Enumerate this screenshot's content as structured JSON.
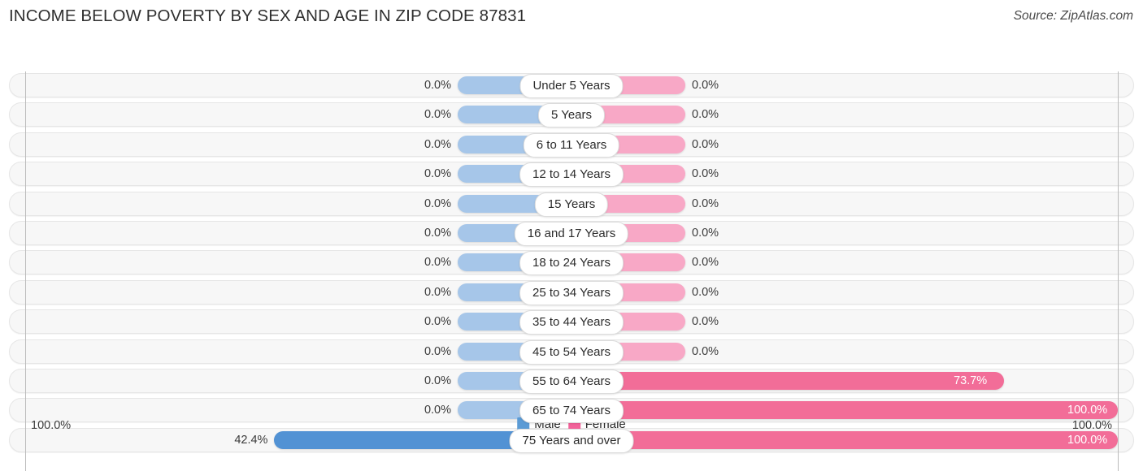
{
  "header": {
    "title": "INCOME BELOW POVERTY BY SEX AND AGE IN ZIP CODE 87831",
    "source": "Source: ZipAtlas.com"
  },
  "footer": {
    "axis_left": "100.0%",
    "axis_right": "100.0%",
    "legend": [
      {
        "label": "Male",
        "color": "#5b9bd5"
      },
      {
        "label": "Female",
        "color": "#f2639a"
      }
    ]
  },
  "colors": {
    "male_zero": "#a6c6e9",
    "female_zero": "#f8a8c6",
    "male_value": "#5292d4",
    "female_value": "#f26d98",
    "track": "#f7f7f7",
    "axis": "#bcbcbc"
  },
  "chart_data": {
    "type": "bar",
    "title": "INCOME BELOW POVERTY BY SEX AND AGE IN ZIP CODE 87831",
    "orientation": "horizontal-diverging",
    "xlabel": "",
    "ylabel": "",
    "xlim": [
      0,
      100
    ],
    "grid": false,
    "legend_position": "bottom-center",
    "categories": [
      "Under 5 Years",
      "5 Years",
      "6 to 11 Years",
      "12 to 14 Years",
      "15 Years",
      "16 and 17 Years",
      "18 to 24 Years",
      "25 to 34 Years",
      "35 to 44 Years",
      "45 to 54 Years",
      "55 to 64 Years",
      "65 to 74 Years",
      "75 Years and over"
    ],
    "series": [
      {
        "name": "Male",
        "values": [
          0.0,
          0.0,
          0.0,
          0.0,
          0.0,
          0.0,
          0.0,
          0.0,
          0.0,
          0.0,
          0.0,
          0.0,
          42.4
        ],
        "labels": [
          "0.0%",
          "0.0%",
          "0.0%",
          "0.0%",
          "0.0%",
          "0.0%",
          "0.0%",
          "0.0%",
          "0.0%",
          "0.0%",
          "0.0%",
          "0.0%",
          "42.4%"
        ]
      },
      {
        "name": "Female",
        "values": [
          0.0,
          0.0,
          0.0,
          0.0,
          0.0,
          0.0,
          0.0,
          0.0,
          0.0,
          0.0,
          73.7,
          100.0,
          100.0
        ],
        "labels": [
          "0.0%",
          "0.0%",
          "0.0%",
          "0.0%",
          "0.0%",
          "0.0%",
          "0.0%",
          "0.0%",
          "0.0%",
          "0.0%",
          "73.7%",
          "100.0%",
          "100.0%"
        ]
      }
    ]
  }
}
